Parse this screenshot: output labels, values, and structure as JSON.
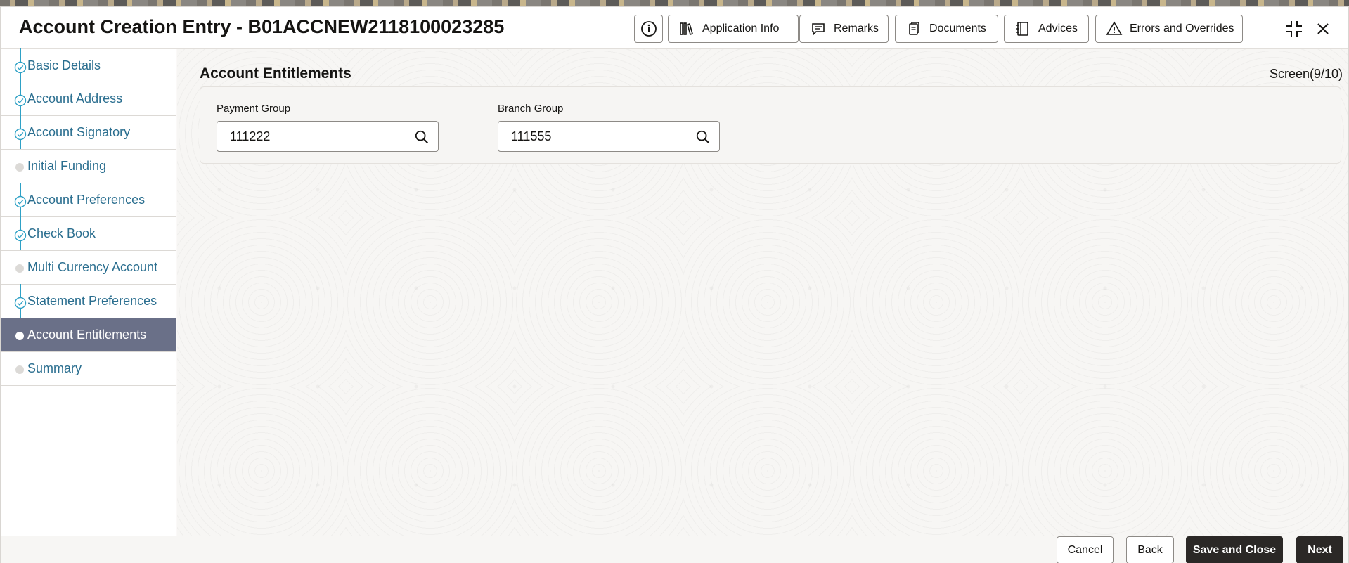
{
  "header": {
    "title": "Account Creation Entry - B01ACCNEW2118100023285",
    "buttons": {
      "info_icon": "info-icon",
      "application_info": "Application Info",
      "remarks": "Remarks",
      "documents": "Documents",
      "advices": "Advices",
      "errors_overrides": "Errors and Overrides"
    }
  },
  "sidebar": {
    "items": [
      {
        "label": "Basic Details",
        "state": "completed"
      },
      {
        "label": "Account Address",
        "state": "completed"
      },
      {
        "label": "Account Signatory",
        "state": "completed"
      },
      {
        "label": "Initial Funding",
        "state": "pending"
      },
      {
        "label": "Account Preferences",
        "state": "completed"
      },
      {
        "label": "Check Book",
        "state": "completed"
      },
      {
        "label": "Multi Currency Account",
        "state": "pending"
      },
      {
        "label": "Statement Preferences",
        "state": "completed"
      },
      {
        "label": "Account Entitlements",
        "state": "active"
      },
      {
        "label": "Summary",
        "state": "pending"
      }
    ]
  },
  "main": {
    "section_title": "Account Entitlements",
    "screen_count": "Screen(9/10)",
    "fields": {
      "payment_group": {
        "label": "Payment Group",
        "value": "111222"
      },
      "branch_group": {
        "label": "Branch Group",
        "value": "111555"
      }
    }
  },
  "footer": {
    "cancel": "Cancel",
    "back": "Back",
    "save_close": "Save and Close",
    "next": "Next"
  },
  "colors": {
    "active_nav": "#6a7088",
    "nav_link": "#2a6e8f",
    "progress_line": "#2ea1c6",
    "primary_button": "#2b2826"
  }
}
